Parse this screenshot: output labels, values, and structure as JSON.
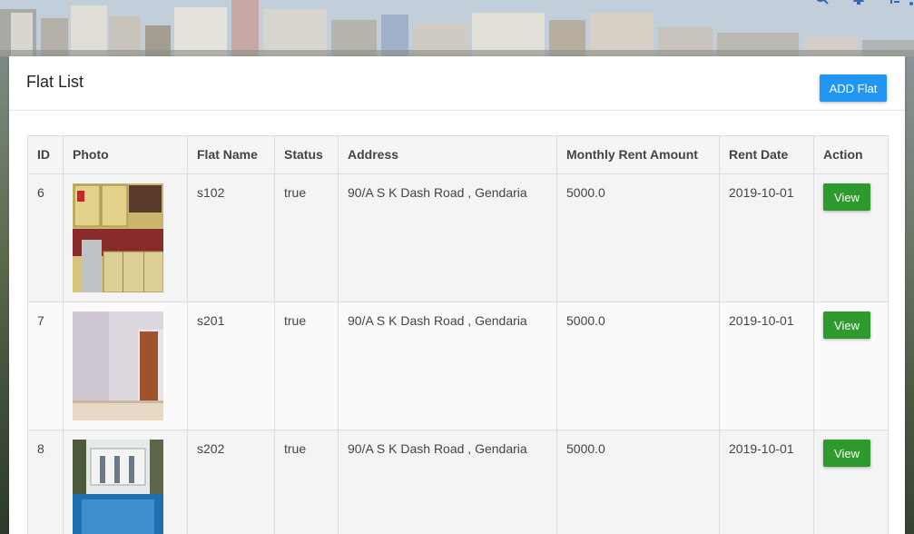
{
  "page": {
    "title": "Flat List"
  },
  "header": {
    "add_label": "ADD Flat",
    "icons": [
      "search-icon",
      "bell-icon",
      "flag-icon",
      "more-vert-icon"
    ]
  },
  "table": {
    "columns": [
      "ID",
      "Photo",
      "Flat Name",
      "Status",
      "Address",
      "Monthly Rent Amount",
      "Rent Date",
      "Action"
    ],
    "rows": [
      {
        "id": "6",
        "photo": "kitchen-photo",
        "name": "s102",
        "status": "true",
        "address": "90/A S K Dash Road , Gendaria",
        "rent": "5000.0",
        "date": "2019-10-01",
        "action": "View"
      },
      {
        "id": "7",
        "photo": "empty-room-photo",
        "name": "s201",
        "status": "true",
        "address": "90/A S K Dash Road , Gendaria",
        "rent": "5000.0",
        "date": "2019-10-01",
        "action": "View"
      },
      {
        "id": "8",
        "photo": "pool-photo",
        "name": "s202",
        "status": "true",
        "address": "90/A S K Dash Road , Gendaria",
        "rent": "5000.0",
        "date": "2019-10-01",
        "action": "View"
      }
    ]
  },
  "colors": {
    "primary": "#2196f3",
    "success": "#2e9a2e"
  }
}
